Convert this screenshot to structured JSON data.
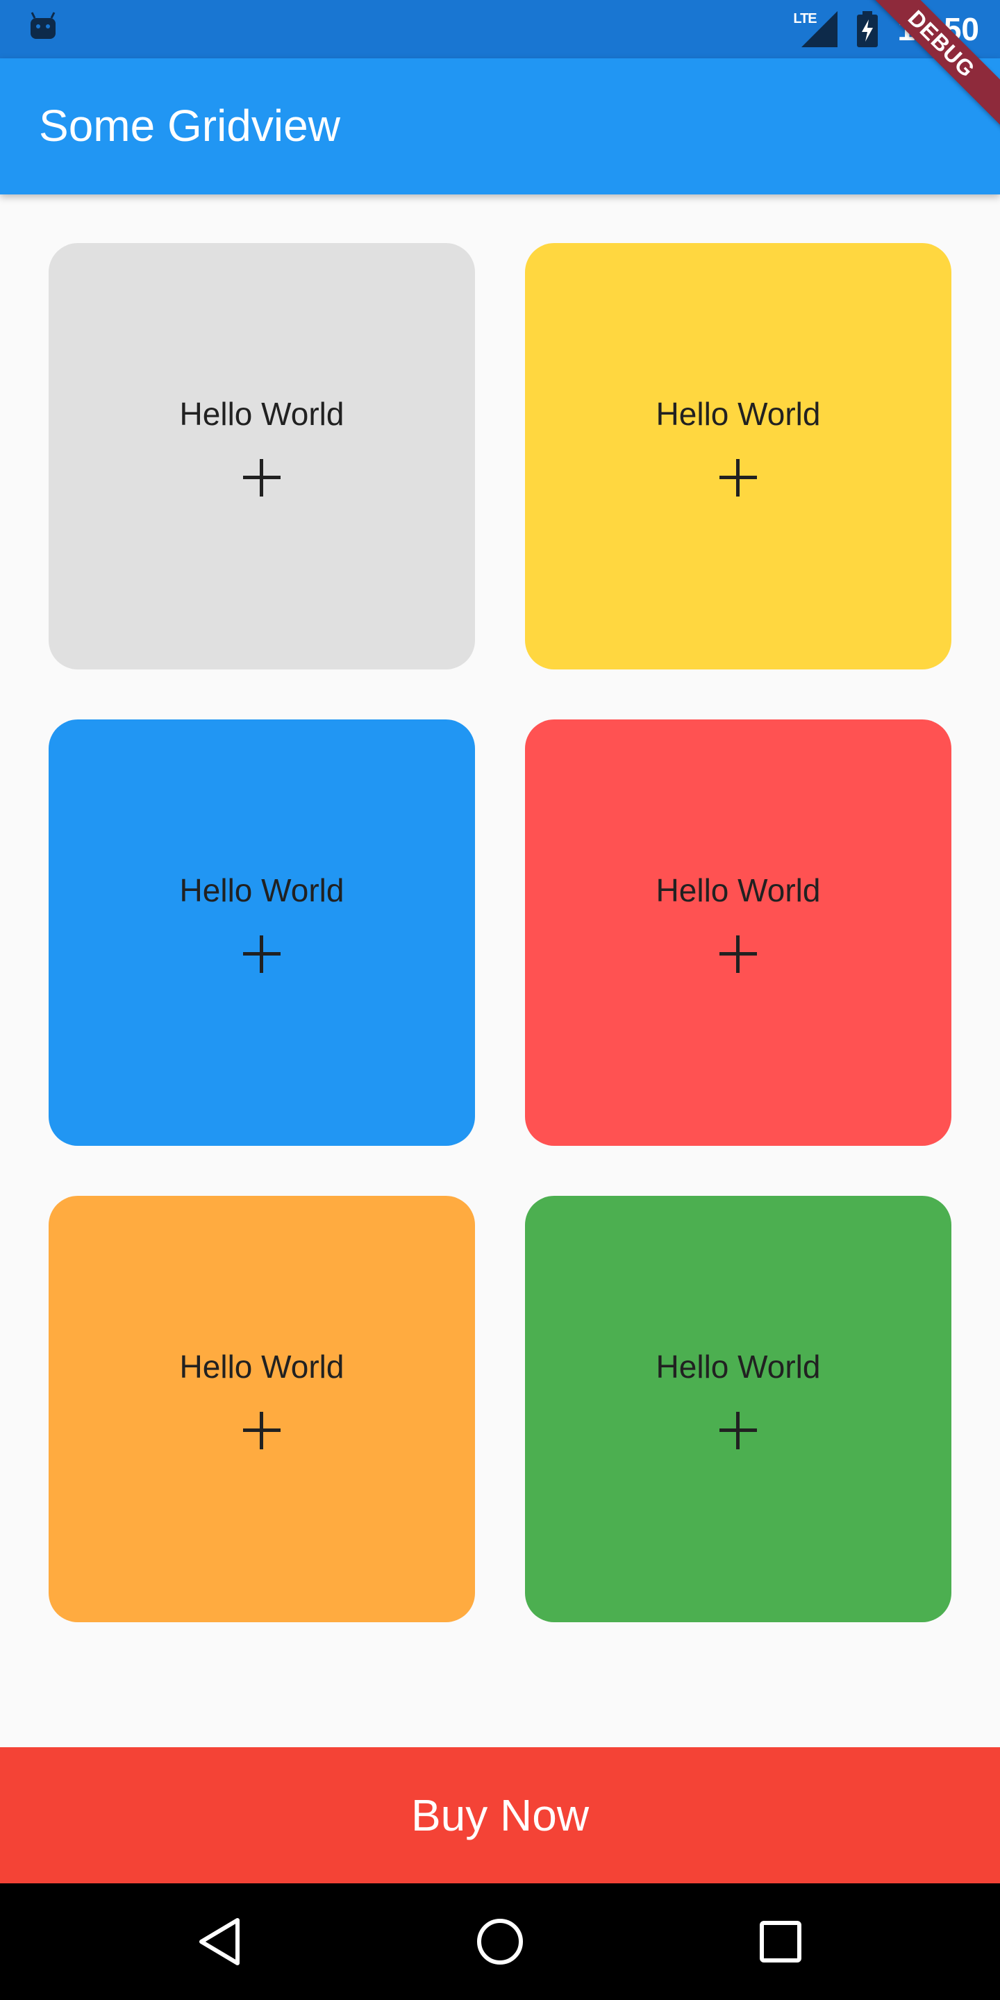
{
  "status_bar": {
    "network": "LTE",
    "time": "10:50",
    "icons": [
      "android-debug-icon",
      "lte-signal-icon",
      "battery-charging-icon"
    ]
  },
  "debug_banner": "DEBUG",
  "app_bar": {
    "title": "Some Gridview"
  },
  "grid": {
    "tiles": [
      {
        "label": "Hello World",
        "icon": "plus-icon",
        "color": "#e0e0e0"
      },
      {
        "label": "Hello World",
        "icon": "plus-icon",
        "color": "#ffd740"
      },
      {
        "label": "Hello World",
        "icon": "plus-icon",
        "color": "#2196f3"
      },
      {
        "label": "Hello World",
        "icon": "plus-icon",
        "color": "#ff5252"
      },
      {
        "label": "Hello World",
        "icon": "plus-icon",
        "color": "#ffab40"
      },
      {
        "label": "Hello World",
        "icon": "plus-icon",
        "color": "#4caf50"
      }
    ]
  },
  "buy_button": {
    "label": "Buy Now",
    "color": "#f44336"
  },
  "nav_bar": {
    "buttons": [
      "back-icon",
      "home-icon",
      "recents-icon"
    ]
  }
}
